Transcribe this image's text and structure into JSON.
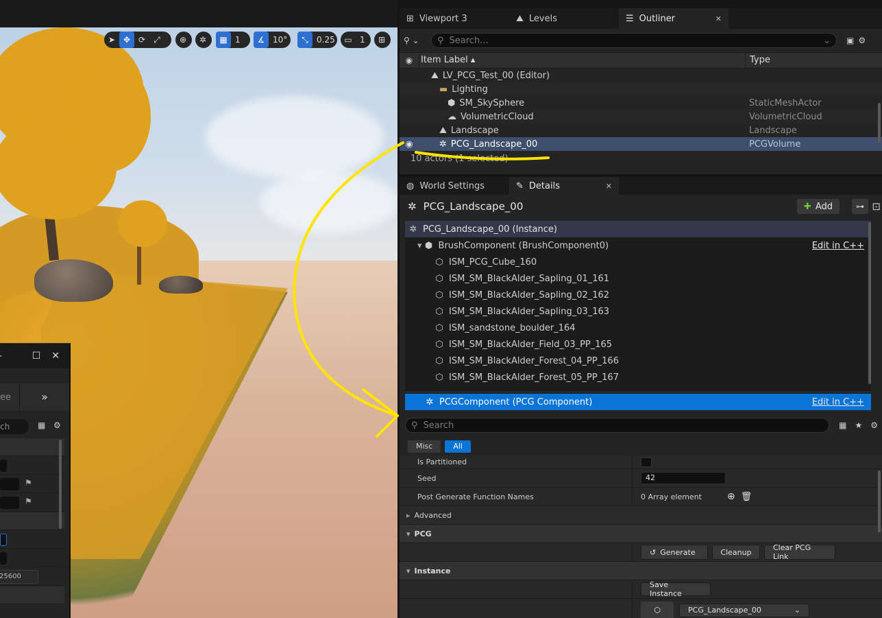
{
  "viewport": {
    "toolbar": {
      "grid_count": "1",
      "angle_snap": "10°",
      "scale_snap": "0.25",
      "camera_speed": "1"
    },
    "float_window": {
      "tab_label": "ee",
      "search_placeholder": "ch",
      "dropdown_value": "25600"
    }
  },
  "outliner": {
    "tabs": [
      {
        "label": "Viewport 3",
        "icon": "viewport-icon"
      },
      {
        "label": "Levels",
        "icon": "levels-icon"
      },
      {
        "label": "Outliner",
        "icon": "outliner-icon"
      }
    ],
    "search_placeholder": "Search...",
    "columns": {
      "label": "Item Label",
      "type": "Type"
    },
    "rows": [
      {
        "label": "LV_PCG_Test_00 (Editor)",
        "type": ""
      },
      {
        "label": "Lighting",
        "type": ""
      },
      {
        "label": "SM_SkySphere",
        "type": "StaticMeshActor"
      },
      {
        "label": "VolumetricCloud",
        "type": "VolumetricCloud"
      },
      {
        "label": "Landscape",
        "type": "Landscape"
      },
      {
        "label": "PCG_Landscape_00",
        "type": "PCGVolume"
      }
    ],
    "footer": "10 actors (1 selected)"
  },
  "details": {
    "tabs": [
      {
        "label": "World Settings",
        "icon": "globe-icon"
      },
      {
        "label": "Details",
        "icon": "pencil-icon"
      }
    ],
    "actor_name": "PCG_Landscape_00",
    "add_label": "Add",
    "components": {
      "root": "PCG_Landscape_00 (Instance)",
      "brush": "BrushComponent (BrushComponent0)",
      "edit_cpp": "Edit in C++",
      "children": [
        "ISM_PCG_Cube_160",
        "ISM_SM_BlackAlder_Sapling_01_161",
        "ISM_SM_BlackAlder_Sapling_02_162",
        "ISM_SM_BlackAlder_Sapling_03_163",
        "ISM_sandstone_boulder_164",
        "ISM_SM_BlackAlder_Field_03_PP_165",
        "ISM_SM_BlackAlder_Forest_04_PP_166",
        "ISM_SM_BlackAlder_Forest_05_PP_167"
      ],
      "pcg": "PCGComponent (PCG Component)",
      "pcg_edit_cpp": "Edit in C++"
    },
    "search_placeholder": "Search",
    "filters": {
      "misc": "Misc",
      "all": "All"
    },
    "props": {
      "is_partitioned": "Is Partitioned",
      "seed_label": "Seed",
      "seed_value": "42",
      "post_gen_label": "Post Generate Function Names",
      "post_gen_value": "0 Array element",
      "advanced": "Advanced"
    },
    "pcg_section": {
      "title": "PCG",
      "generate": "Generate",
      "cleanup": "Cleanup",
      "clear_link": "Clear PCG Link"
    },
    "instance_section": {
      "title": "Instance",
      "save_instance": "Save Instance",
      "asset": "PCG_Landscape_00"
    }
  },
  "colors": {
    "accent": "#0b74d7",
    "selection": "#3d4f6b",
    "annotation": "#ffe400"
  }
}
